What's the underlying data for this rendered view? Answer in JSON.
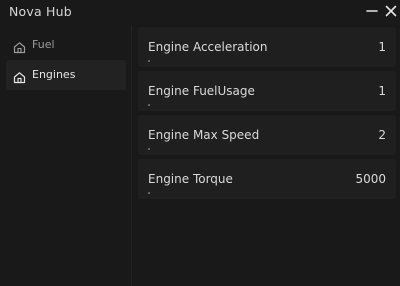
{
  "window": {
    "title": "Nova Hub"
  },
  "sidebar": {
    "items": [
      {
        "label": "Fuel",
        "icon": "home-icon",
        "active": false
      },
      {
        "label": "Engines",
        "icon": "home-icon",
        "active": true
      }
    ]
  },
  "settings": [
    {
      "label": "Engine Acceleration",
      "value": "1",
      "fraction": 0.0
    },
    {
      "label": "Engine FuelUsage",
      "value": "1",
      "fraction": 0.0
    },
    {
      "label": "Engine Max Speed",
      "value": "2",
      "fraction": 0.0
    },
    {
      "label": "Engine Torque",
      "value": "5000",
      "fraction": 0.0
    }
  ],
  "colors": {
    "background": "#191919",
    "row": "#1f1f1f",
    "active_nav": "#222222",
    "text": "#dadada",
    "muted_text": "#9b9b9b"
  }
}
